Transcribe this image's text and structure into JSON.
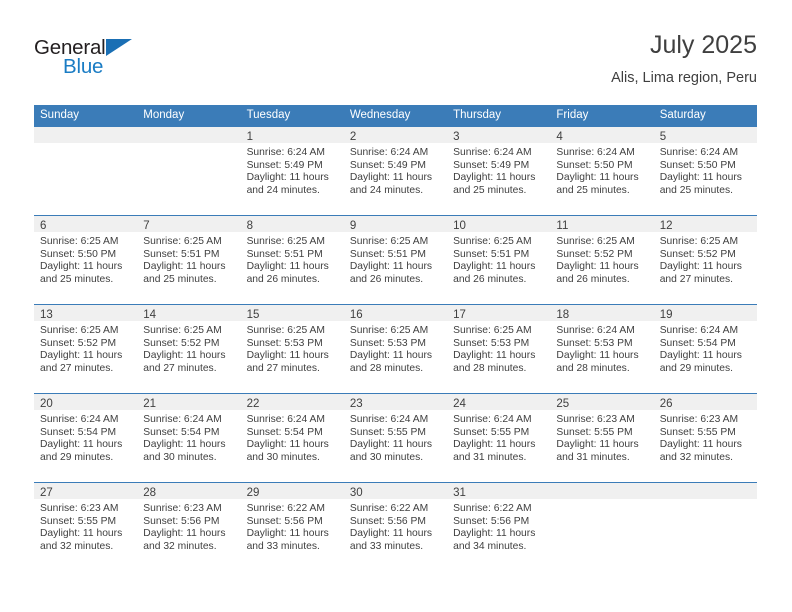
{
  "brand": {
    "name_top": "General",
    "name_bottom": "Blue",
    "triangle_color": "#1a6fb4",
    "blue_color": "#1a7cc4"
  },
  "header": {
    "month_title": "July 2025",
    "location": "Alis, Lima region, Peru"
  },
  "theme": {
    "accent": "#3b7cb8",
    "daynum_band": "#f0f0f0",
    "text": "#3f3f3f"
  },
  "weekday_headers": [
    "Sunday",
    "Monday",
    "Tuesday",
    "Wednesday",
    "Thursday",
    "Friday",
    "Saturday"
  ],
  "weeks": [
    [
      {
        "day": "",
        "sunrise": "",
        "sunset": "",
        "daylight_line1": "",
        "daylight_line2": ""
      },
      {
        "day": "",
        "sunrise": "",
        "sunset": "",
        "daylight_line1": "",
        "daylight_line2": ""
      },
      {
        "day": "1",
        "sunrise": "Sunrise: 6:24 AM",
        "sunset": "Sunset: 5:49 PM",
        "daylight_line1": "Daylight: 11 hours",
        "daylight_line2": "and 24 minutes."
      },
      {
        "day": "2",
        "sunrise": "Sunrise: 6:24 AM",
        "sunset": "Sunset: 5:49 PM",
        "daylight_line1": "Daylight: 11 hours",
        "daylight_line2": "and 24 minutes."
      },
      {
        "day": "3",
        "sunrise": "Sunrise: 6:24 AM",
        "sunset": "Sunset: 5:49 PM",
        "daylight_line1": "Daylight: 11 hours",
        "daylight_line2": "and 25 minutes."
      },
      {
        "day": "4",
        "sunrise": "Sunrise: 6:24 AM",
        "sunset": "Sunset: 5:50 PM",
        "daylight_line1": "Daylight: 11 hours",
        "daylight_line2": "and 25 minutes."
      },
      {
        "day": "5",
        "sunrise": "Sunrise: 6:24 AM",
        "sunset": "Sunset: 5:50 PM",
        "daylight_line1": "Daylight: 11 hours",
        "daylight_line2": "and 25 minutes."
      }
    ],
    [
      {
        "day": "6",
        "sunrise": "Sunrise: 6:25 AM",
        "sunset": "Sunset: 5:50 PM",
        "daylight_line1": "Daylight: 11 hours",
        "daylight_line2": "and 25 minutes."
      },
      {
        "day": "7",
        "sunrise": "Sunrise: 6:25 AM",
        "sunset": "Sunset: 5:51 PM",
        "daylight_line1": "Daylight: 11 hours",
        "daylight_line2": "and 25 minutes."
      },
      {
        "day": "8",
        "sunrise": "Sunrise: 6:25 AM",
        "sunset": "Sunset: 5:51 PM",
        "daylight_line1": "Daylight: 11 hours",
        "daylight_line2": "and 26 minutes."
      },
      {
        "day": "9",
        "sunrise": "Sunrise: 6:25 AM",
        "sunset": "Sunset: 5:51 PM",
        "daylight_line1": "Daylight: 11 hours",
        "daylight_line2": "and 26 minutes."
      },
      {
        "day": "10",
        "sunrise": "Sunrise: 6:25 AM",
        "sunset": "Sunset: 5:51 PM",
        "daylight_line1": "Daylight: 11 hours",
        "daylight_line2": "and 26 minutes."
      },
      {
        "day": "11",
        "sunrise": "Sunrise: 6:25 AM",
        "sunset": "Sunset: 5:52 PM",
        "daylight_line1": "Daylight: 11 hours",
        "daylight_line2": "and 26 minutes."
      },
      {
        "day": "12",
        "sunrise": "Sunrise: 6:25 AM",
        "sunset": "Sunset: 5:52 PM",
        "daylight_line1": "Daylight: 11 hours",
        "daylight_line2": "and 27 minutes."
      }
    ],
    [
      {
        "day": "13",
        "sunrise": "Sunrise: 6:25 AM",
        "sunset": "Sunset: 5:52 PM",
        "daylight_line1": "Daylight: 11 hours",
        "daylight_line2": "and 27 minutes."
      },
      {
        "day": "14",
        "sunrise": "Sunrise: 6:25 AM",
        "sunset": "Sunset: 5:52 PM",
        "daylight_line1": "Daylight: 11 hours",
        "daylight_line2": "and 27 minutes."
      },
      {
        "day": "15",
        "sunrise": "Sunrise: 6:25 AM",
        "sunset": "Sunset: 5:53 PM",
        "daylight_line1": "Daylight: 11 hours",
        "daylight_line2": "and 27 minutes."
      },
      {
        "day": "16",
        "sunrise": "Sunrise: 6:25 AM",
        "sunset": "Sunset: 5:53 PM",
        "daylight_line1": "Daylight: 11 hours",
        "daylight_line2": "and 28 minutes."
      },
      {
        "day": "17",
        "sunrise": "Sunrise: 6:25 AM",
        "sunset": "Sunset: 5:53 PM",
        "daylight_line1": "Daylight: 11 hours",
        "daylight_line2": "and 28 minutes."
      },
      {
        "day": "18",
        "sunrise": "Sunrise: 6:24 AM",
        "sunset": "Sunset: 5:53 PM",
        "daylight_line1": "Daylight: 11 hours",
        "daylight_line2": "and 28 minutes."
      },
      {
        "day": "19",
        "sunrise": "Sunrise: 6:24 AM",
        "sunset": "Sunset: 5:54 PM",
        "daylight_line1": "Daylight: 11 hours",
        "daylight_line2": "and 29 minutes."
      }
    ],
    [
      {
        "day": "20",
        "sunrise": "Sunrise: 6:24 AM",
        "sunset": "Sunset: 5:54 PM",
        "daylight_line1": "Daylight: 11 hours",
        "daylight_line2": "and 29 minutes."
      },
      {
        "day": "21",
        "sunrise": "Sunrise: 6:24 AM",
        "sunset": "Sunset: 5:54 PM",
        "daylight_line1": "Daylight: 11 hours",
        "daylight_line2": "and 30 minutes."
      },
      {
        "day": "22",
        "sunrise": "Sunrise: 6:24 AM",
        "sunset": "Sunset: 5:54 PM",
        "daylight_line1": "Daylight: 11 hours",
        "daylight_line2": "and 30 minutes."
      },
      {
        "day": "23",
        "sunrise": "Sunrise: 6:24 AM",
        "sunset": "Sunset: 5:55 PM",
        "daylight_line1": "Daylight: 11 hours",
        "daylight_line2": "and 30 minutes."
      },
      {
        "day": "24",
        "sunrise": "Sunrise: 6:24 AM",
        "sunset": "Sunset: 5:55 PM",
        "daylight_line1": "Daylight: 11 hours",
        "daylight_line2": "and 31 minutes."
      },
      {
        "day": "25",
        "sunrise": "Sunrise: 6:23 AM",
        "sunset": "Sunset: 5:55 PM",
        "daylight_line1": "Daylight: 11 hours",
        "daylight_line2": "and 31 minutes."
      },
      {
        "day": "26",
        "sunrise": "Sunrise: 6:23 AM",
        "sunset": "Sunset: 5:55 PM",
        "daylight_line1": "Daylight: 11 hours",
        "daylight_line2": "and 32 minutes."
      }
    ],
    [
      {
        "day": "27",
        "sunrise": "Sunrise: 6:23 AM",
        "sunset": "Sunset: 5:55 PM",
        "daylight_line1": "Daylight: 11 hours",
        "daylight_line2": "and 32 minutes."
      },
      {
        "day": "28",
        "sunrise": "Sunrise: 6:23 AM",
        "sunset": "Sunset: 5:56 PM",
        "daylight_line1": "Daylight: 11 hours",
        "daylight_line2": "and 32 minutes."
      },
      {
        "day": "29",
        "sunrise": "Sunrise: 6:22 AM",
        "sunset": "Sunset: 5:56 PM",
        "daylight_line1": "Daylight: 11 hours",
        "daylight_line2": "and 33 minutes."
      },
      {
        "day": "30",
        "sunrise": "Sunrise: 6:22 AM",
        "sunset": "Sunset: 5:56 PM",
        "daylight_line1": "Daylight: 11 hours",
        "daylight_line2": "and 33 minutes."
      },
      {
        "day": "31",
        "sunrise": "Sunrise: 6:22 AM",
        "sunset": "Sunset: 5:56 PM",
        "daylight_line1": "Daylight: 11 hours",
        "daylight_line2": "and 34 minutes."
      },
      {
        "day": "",
        "sunrise": "",
        "sunset": "",
        "daylight_line1": "",
        "daylight_line2": ""
      },
      {
        "day": "",
        "sunrise": "",
        "sunset": "",
        "daylight_line1": "",
        "daylight_line2": ""
      }
    ]
  ]
}
